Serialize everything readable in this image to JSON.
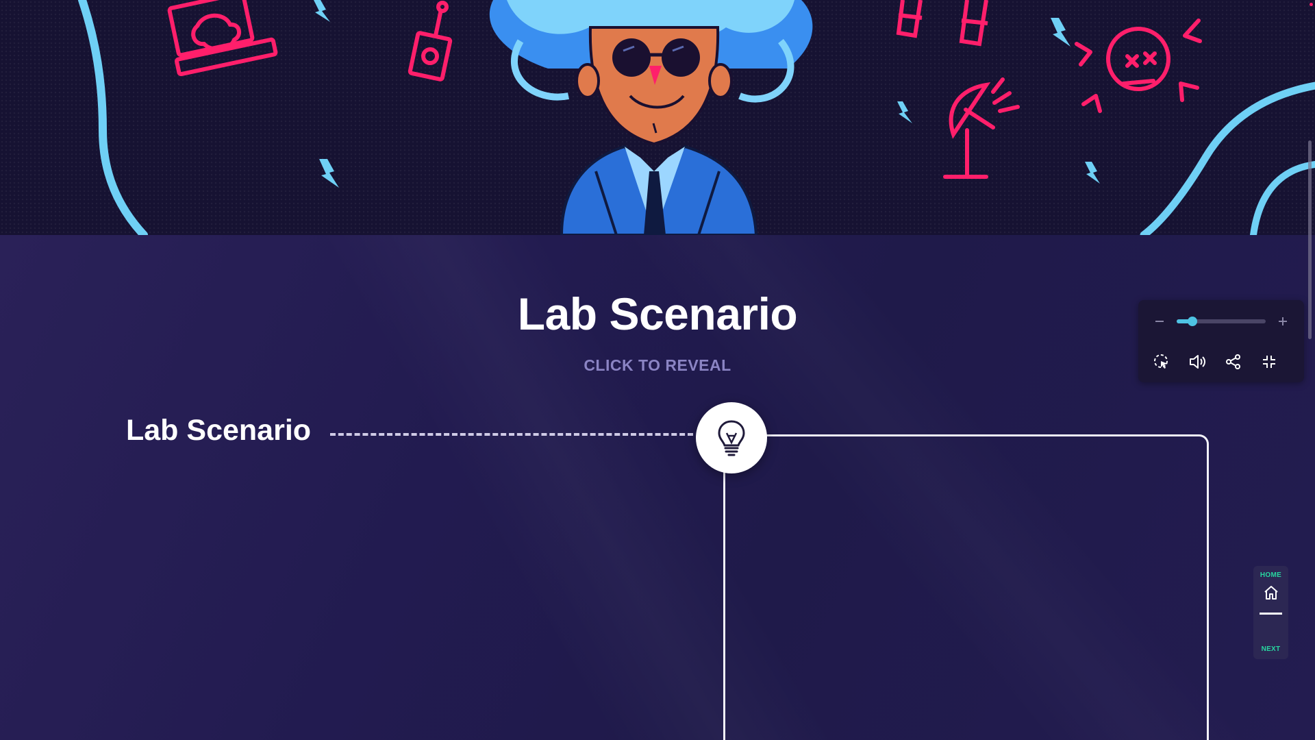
{
  "hero": {
    "illustration": "mad-scientist-cartoon",
    "accent_pink": "#ff1f6b",
    "accent_blue": "#6fd0f5"
  },
  "main": {
    "title": "Lab Scenario",
    "subtitle": "CLICK TO REVEAL",
    "scenario_label": "Lab Scenario",
    "reveal_icon": "lightbulb-icon"
  },
  "controls": {
    "zoom_out_icon": "minus-icon",
    "zoom_in_icon": "plus-icon",
    "zoom_level": 0.18,
    "buttons": [
      "cursor-click-icon",
      "volume-icon",
      "share-icon",
      "collapse-icon"
    ]
  },
  "sidenav": {
    "home_label": "HOME",
    "next_label": "NEXT",
    "accent": "#28d6a0"
  }
}
